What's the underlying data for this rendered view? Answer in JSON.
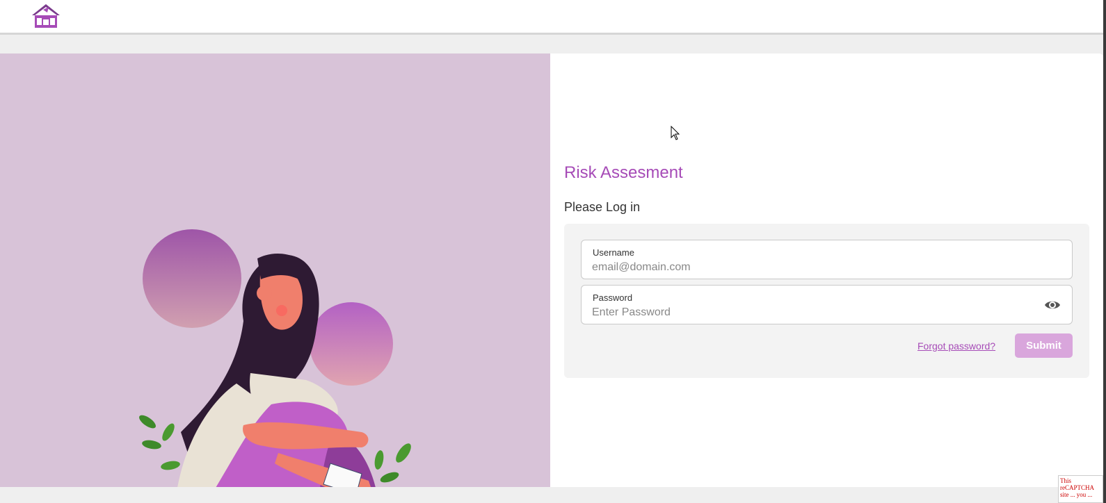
{
  "header": {
    "logo_icon": "house-logo-icon"
  },
  "login": {
    "title": "Risk Assesment",
    "subtitle": "Please Log in",
    "username_label": "Username",
    "username_placeholder": "email@domain.com",
    "password_label": "Password",
    "password_placeholder": "Enter Password",
    "show_password_icon": "eye-icon",
    "forgot_link": "Forgot password?",
    "submit_label": "Submit"
  },
  "captcha": {
    "text": "This reCAPTCHA site ... you ..."
  },
  "colors": {
    "accent": "#a64bb7",
    "panel_bg": "#d8c3d8",
    "submit_bg": "#d9a6dc"
  }
}
